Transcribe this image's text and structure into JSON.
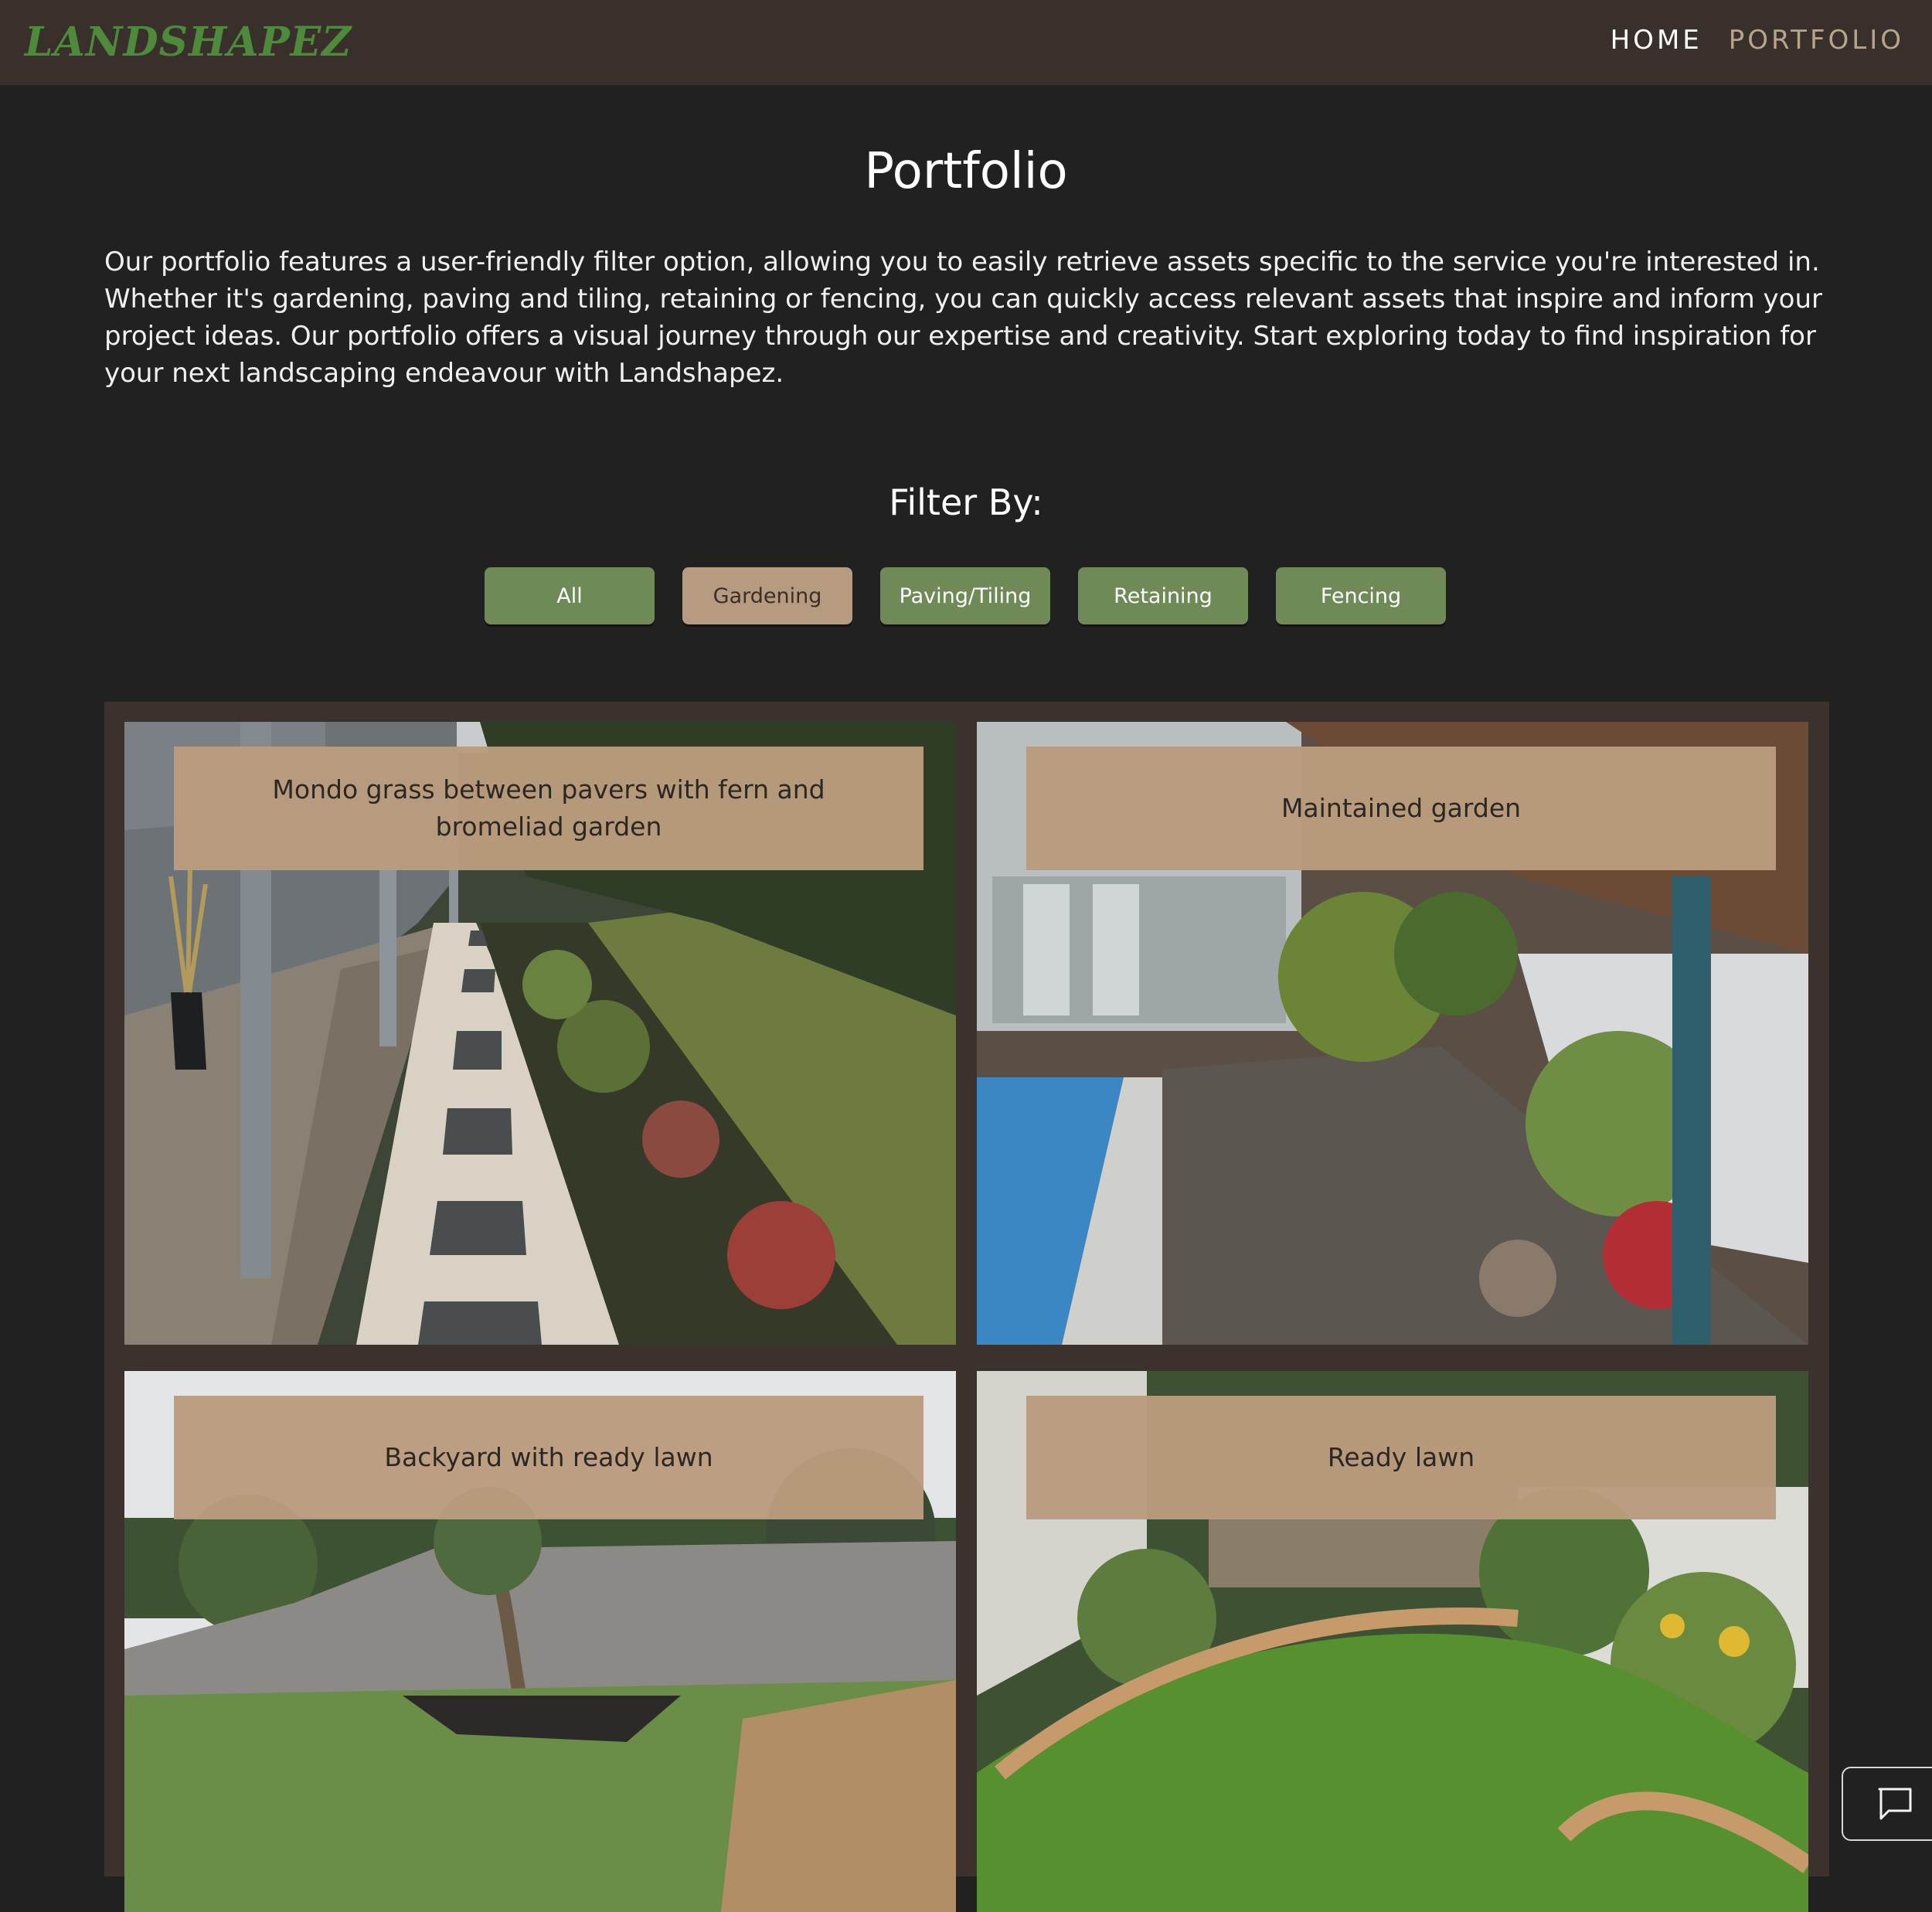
{
  "brand": {
    "logo_text": "LANDSHAPEZ",
    "logo_color": "#4d8a3c"
  },
  "nav": {
    "items": [
      {
        "label": "HOME",
        "active": false
      },
      {
        "label": "PORTFOLIO",
        "active": true
      }
    ]
  },
  "page": {
    "title": "Portfolio",
    "intro": "Our portfolio features a user-friendly filter option, allowing you to easily retrieve assets specific to the service you're interested in. Whether it's gardening, paving and tiling, retaining or fencing, you can quickly access relevant assets that inspire and inform your project ideas. Our portfolio offers a visual journey through our expertise and creativity. Start exploring today to find inspiration for your next landscaping endeavour with Landshapez."
  },
  "filter": {
    "heading": "Filter By:",
    "options": [
      {
        "label": "All",
        "active": false
      },
      {
        "label": "Gardening",
        "active": true
      },
      {
        "label": "Paving/Tiling",
        "active": false
      },
      {
        "label": "Retaining",
        "active": false
      },
      {
        "label": "Fencing",
        "active": false
      }
    ]
  },
  "gallery": {
    "items": [
      {
        "caption": "Mondo grass between pavers with fern and bromeliad garden"
      },
      {
        "caption": "Maintained garden"
      },
      {
        "caption": "Backyard with ready lawn"
      },
      {
        "caption": "Ready lawn"
      }
    ]
  },
  "chat": {
    "icon": "chat-bubble-icon"
  },
  "colors": {
    "background": "#212121",
    "header": "#3a302b",
    "filter_button": "#6f8a57",
    "filter_button_active": "#b79b80",
    "caption_bg": "#ba9c7e",
    "gallery_frame": "#3b322d"
  }
}
